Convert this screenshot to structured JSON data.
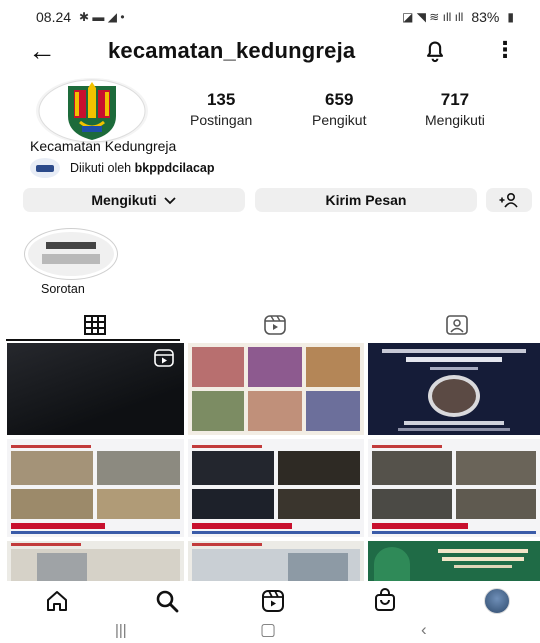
{
  "status_bar": {
    "time": "08.24",
    "battery": "83%"
  },
  "header": {
    "title": "kecamatan_kedungreja"
  },
  "profile": {
    "display_name": "Kecamatan Kedungreja",
    "stats": [
      {
        "value": "135",
        "label": "Postingan"
      },
      {
        "value": "659",
        "label": "Pengikut"
      },
      {
        "value": "717",
        "label": "Mengikuti"
      }
    ],
    "followed_by_prefix": "Diikuti oleh",
    "followed_by_user": "bkppdcilacap"
  },
  "actions": {
    "follow_label": "Mengikuti",
    "message_label": "Kirim Pesan"
  },
  "highlights": [
    {
      "label": "Sorotan"
    }
  ],
  "colors": {
    "button_bg": "#efefef",
    "text": "#111111"
  }
}
